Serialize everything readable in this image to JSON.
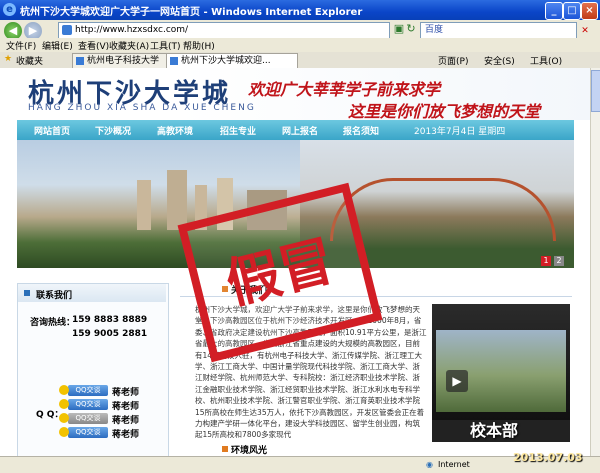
{
  "window": {
    "title": "杭州下沙大学城欢迎广大学子一网站首页 - Windows Internet Explorer",
    "minimize": "_",
    "maximize": "□",
    "close": "×"
  },
  "addressbar": {
    "url": "http://www.hzxsdxc.com/",
    "search_placeholder": "百度",
    "back_icon": "back-arrow",
    "forward_icon": "forward-arrow"
  },
  "menu": [
    "文件(F)",
    "编辑(E)",
    "查看(V)",
    "收藏夹(A)",
    "工具(T)",
    "帮助(H)"
  ],
  "favorites": {
    "label": "收藏夹",
    "tabs": [
      "杭州电子科技大学",
      "杭州下沙大学城欢迎..."
    ]
  },
  "toolbar_right": [
    "页面(P)",
    "安全(S)",
    "工具(O)"
  ],
  "site": {
    "logo": "杭州下沙大学城",
    "logo_pinyin": "HANG ZHOU XIA SHA DA XUE CHENG",
    "slogan_line1": "欢迎广大莘莘学子前来求学",
    "slogan_line2": "这里是你们放飞梦想的天堂",
    "nav": [
      "网站首页",
      "下沙概况",
      "高教环境",
      "招生专业",
      "网上报名",
      "报名须知"
    ],
    "date": "2013年7月4日 星期四",
    "pager": [
      "1",
      "2"
    ],
    "stamp": "假冒"
  },
  "contact": {
    "title": "联系我们",
    "hotline_label": "咨询热线：",
    "phones": [
      "159 8883 8889",
      "159 9005 2881"
    ],
    "qq_label": "Q Q：",
    "qq_badge": "QQ交谈",
    "teachers": [
      "蒋老师",
      "蒋老师",
      "蒋老师",
      "蒋老师"
    ]
  },
  "about": {
    "title": "关于我们",
    "text": "杭州下沙大学城，欢迎广大学子前来求学，这里是你们放飞梦想的天堂。下沙高教园区位于杭州下沙经济技术开发区，于2000年8月，省委、省政府决定建设杭州下沙高教园区，面积10.91平方公里，是浙江省最大的高教园区，也是浙江省重点建设的大规模的高教园区，目前有14所高校入驻，有杭州电子科技大学、浙江传媒学院、浙江理工大学、浙江工商大学、中国计量学院现代科技学院、浙江工商大学、浙江财经学院、杭州师范大学、专科院校：浙江经济职业技术学院、浙江金融职业技术学院、浙江经贸职业技术学院、浙江水利水电专科学校、杭州职业技术学院、浙江警官职业学院、浙江育英职业技术学院15所高校在师生达35万人，依托下沙高教园区，开发区管委会正在着力构建产学研一体化平台，建设大学科技园区、留学生创业园，构筑起15所高校和7800多家现代"
  },
  "scenery": {
    "title": "环境风光"
  },
  "video": {
    "campus_label": "校本部",
    "date_overlay": "2013.07.03"
  },
  "status": {
    "zone": "Internet",
    "zoom": "100%"
  }
}
